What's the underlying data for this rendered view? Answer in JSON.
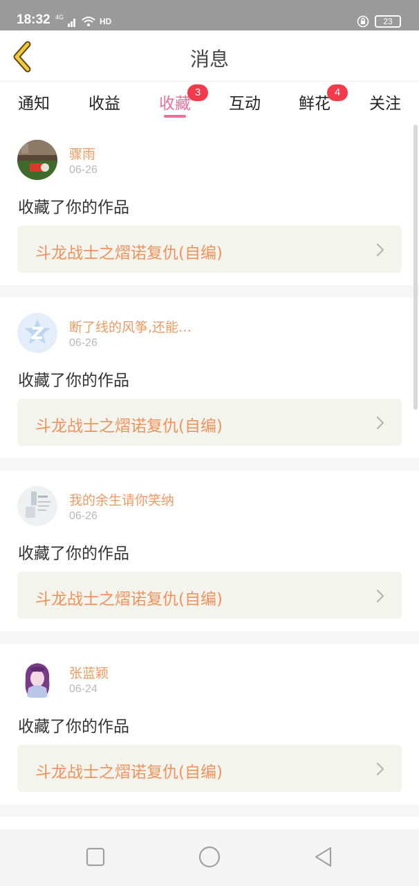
{
  "status_bar": {
    "time": "18:32",
    "network": "4G",
    "hd": "HD",
    "battery": "23"
  },
  "header": {
    "title": "消息",
    "back_icon": "back-chevron-icon"
  },
  "tabs": [
    {
      "label": "通知",
      "badge": null
    },
    {
      "label": "收益",
      "badge": null
    },
    {
      "label": "收藏",
      "badge": "3",
      "active": true
    },
    {
      "label": "互动",
      "badge": null
    },
    {
      "label": "鲜花",
      "badge": "4"
    },
    {
      "label": "关注",
      "badge": null
    }
  ],
  "notifications": [
    {
      "username": "骤雨",
      "date": "06-26",
      "action": "收藏了你的作品",
      "work": "斗龙战士之熠诺复仇(自编)"
    },
    {
      "username": "断了线的风筝,还能…",
      "date": "06-26",
      "action": "收藏了你的作品",
      "work": "斗龙战士之熠诺复仇(自编)"
    },
    {
      "username": "我的余生请你笑纳",
      "date": "06-26",
      "action": "收藏了你的作品",
      "work": "斗龙战士之熠诺复仇(自编)"
    },
    {
      "username": "张蓝颖",
      "date": "06-24",
      "action": "收藏了你的作品",
      "work": "斗龙战士之熠诺复仇(自编)"
    }
  ],
  "colors": {
    "accent": "#ee6e9c",
    "username": "#f09a62",
    "work_title": "#f0925a",
    "badge": "#f23a4a"
  }
}
